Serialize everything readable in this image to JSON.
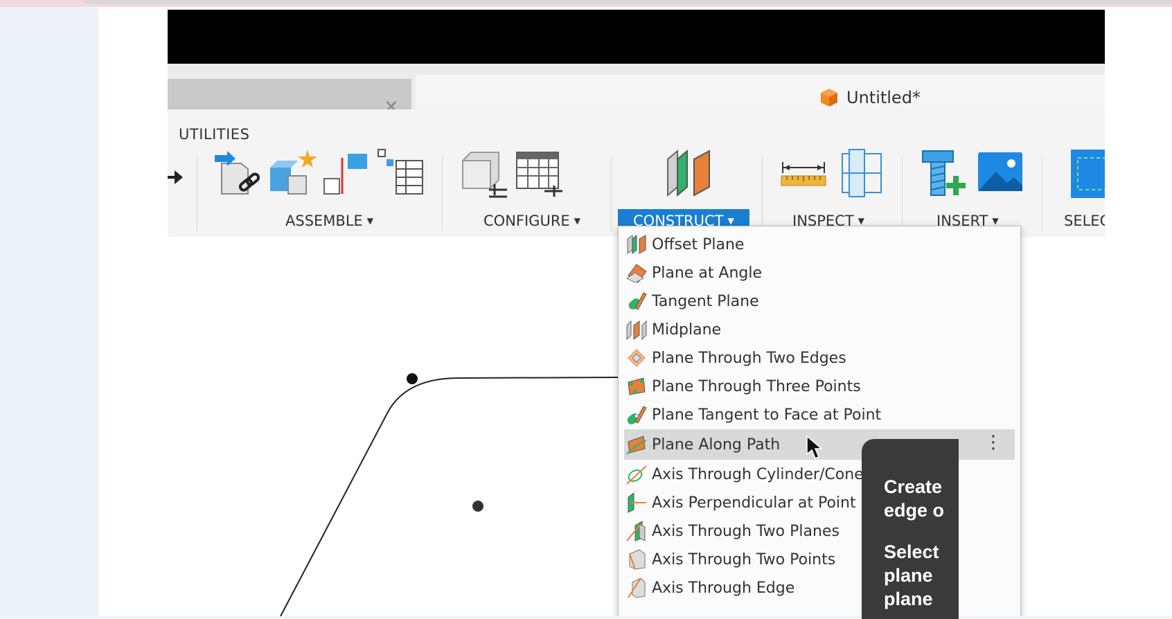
{
  "window": {
    "document_title": "Untitled*"
  },
  "toolbar": {
    "tab_label": "UTILITIES",
    "groups": {
      "assemble": "ASSEMBLE",
      "configure": "CONFIGURE",
      "construct": "CONSTRUCT",
      "inspect": "INSPECT",
      "insert": "INSERT",
      "select": "SELEC"
    },
    "active_group": "construct"
  },
  "construct_menu": {
    "items": [
      {
        "label": "Offset Plane",
        "icon": "offset-plane-icon"
      },
      {
        "label": "Plane at Angle",
        "icon": "plane-at-angle-icon"
      },
      {
        "label": "Tangent Plane",
        "icon": "tangent-plane-icon"
      },
      {
        "label": "Midplane",
        "icon": "midplane-icon"
      },
      {
        "label": "Plane Through Two Edges",
        "icon": "plane-two-edges-icon"
      },
      {
        "label": "Plane Through Three Points",
        "icon": "plane-three-points-icon"
      },
      {
        "label": "Plane Tangent to Face at Point",
        "icon": "plane-tangent-face-icon"
      },
      {
        "label": "Plane Along Path",
        "icon": "plane-along-path-icon",
        "highlighted": true
      },
      {
        "label": "Axis Through Cylinder/Cone/Torus",
        "icon": "axis-cylinder-icon"
      },
      {
        "label": "Axis Perpendicular at Point",
        "icon": "axis-perpendicular-icon"
      },
      {
        "label": "Axis Through Two Planes",
        "icon": "axis-two-planes-icon"
      },
      {
        "label": "Axis Through Two Points",
        "icon": "axis-two-points-icon"
      },
      {
        "label": "Axis Through Edge",
        "icon": "axis-edge-icon"
      }
    ],
    "more_glyph": "⋮"
  },
  "tooltip": {
    "line1": "Create",
    "line2": "edge o",
    "line3": "Select",
    "line4": "plane",
    "line5": "plane"
  },
  "colors": {
    "accent": "#1a7fd1",
    "highlight_row": "#d9d9d9",
    "tooltip_bg": "#3a3a3a",
    "plane_orange": "#e8803a",
    "plane_green": "#2fb36a"
  }
}
